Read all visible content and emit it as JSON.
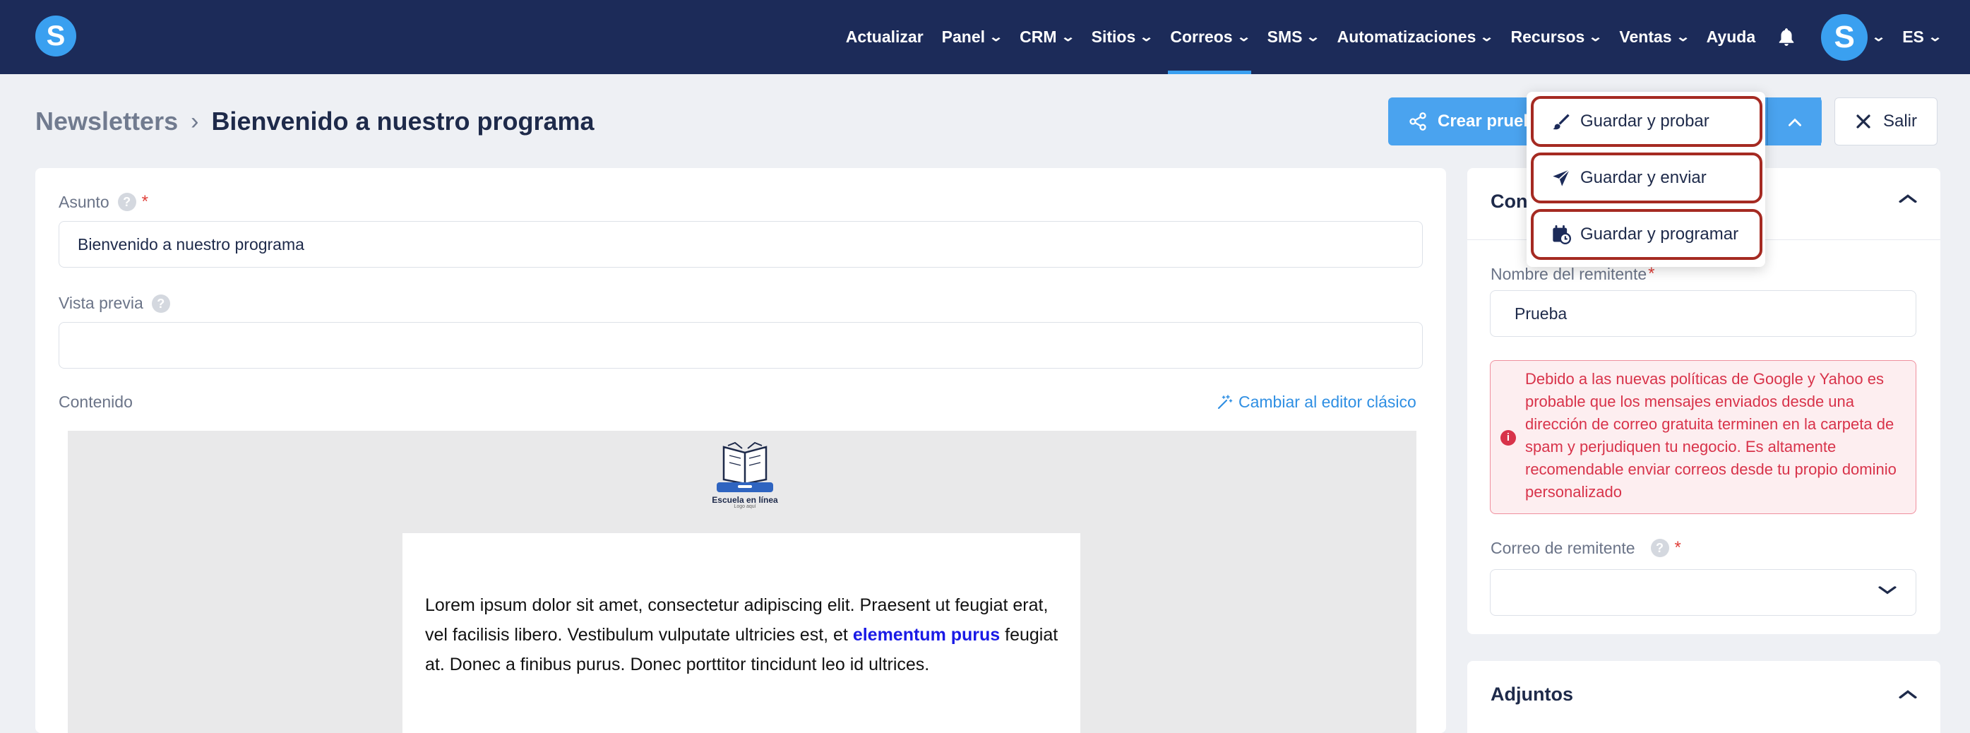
{
  "brand": {
    "logo_letter": "S"
  },
  "nav": {
    "items": [
      {
        "label": "Actualizar",
        "has_caret": false
      },
      {
        "label": "Panel",
        "has_caret": true
      },
      {
        "label": "CRM",
        "has_caret": true
      },
      {
        "label": "Sitios",
        "has_caret": true
      },
      {
        "label": "Correos",
        "has_caret": true,
        "active": true
      },
      {
        "label": "SMS",
        "has_caret": true
      },
      {
        "label": "Automatizaciones",
        "has_caret": true
      },
      {
        "label": "Recursos",
        "has_caret": true
      },
      {
        "label": "Ventas",
        "has_caret": true
      },
      {
        "label": "Ayuda",
        "has_caret": false
      }
    ],
    "caret_glyph": "⌄",
    "bell_icon": "bell-icon",
    "avatar_letter": "S",
    "language": "ES"
  },
  "breadcrumb": {
    "parent": "Newsletters",
    "separator": "›",
    "current": "Bienvenido a nuestro programa"
  },
  "toolbar": {
    "primary_label": "Crear prueba",
    "primary_icon": "share-icon",
    "exit_label": "Salir"
  },
  "save_menu": {
    "items": [
      {
        "label": "Guardar y probar",
        "icon": "brush-icon"
      },
      {
        "label": "Guardar y enviar",
        "icon": "send-icon"
      },
      {
        "label": "Guardar y programar",
        "icon": "calendar-clock-icon"
      }
    ]
  },
  "form": {
    "subject_label": "Asunto",
    "subject_value": "Bienvenido a nuestro programa",
    "preview_label": "Vista previa",
    "preview_value": "",
    "content_label": "Contenido",
    "switch_editor_label": "Cambiar al editor clásico",
    "required_mark": "*"
  },
  "email_preview": {
    "logo_title": "Escuela en línea",
    "logo_subtitle": "Logo aquí",
    "paragraph_before": "Lorem ipsum dolor sit amet, consectetur adipiscing elit. Praesent ut feugiat erat, vel facilisis libero. Vestibulum vulputate ultricies est, et ",
    "link_text": "elementum purus",
    "paragraph_after": " feugiat at. Donec a finibus purus. Donec porttitor tincidunt leo id ultrices."
  },
  "side_panel": {
    "config_title": "Configuración",
    "sender_name_label": "Nombre del remitente",
    "sender_name_value": "Prueba",
    "warning_text": "Debido a las nuevas políticas de Google y Yahoo es probable que los mensajes enviados desde una dirección de correo gratuita terminen en la carpeta de spam y perjudiquen tu negocio. Es altamente recomendable enviar correos desde tu propio dominio personalizado",
    "sender_email_label": "Correo de remitente",
    "sender_email_value": "",
    "attachments_title": "Adjuntos"
  },
  "colors": {
    "nav_bg": "#1c2b59",
    "accent": "#4aa3ef",
    "highlight_outline": "#a52a22",
    "warning": "#d8334a"
  }
}
